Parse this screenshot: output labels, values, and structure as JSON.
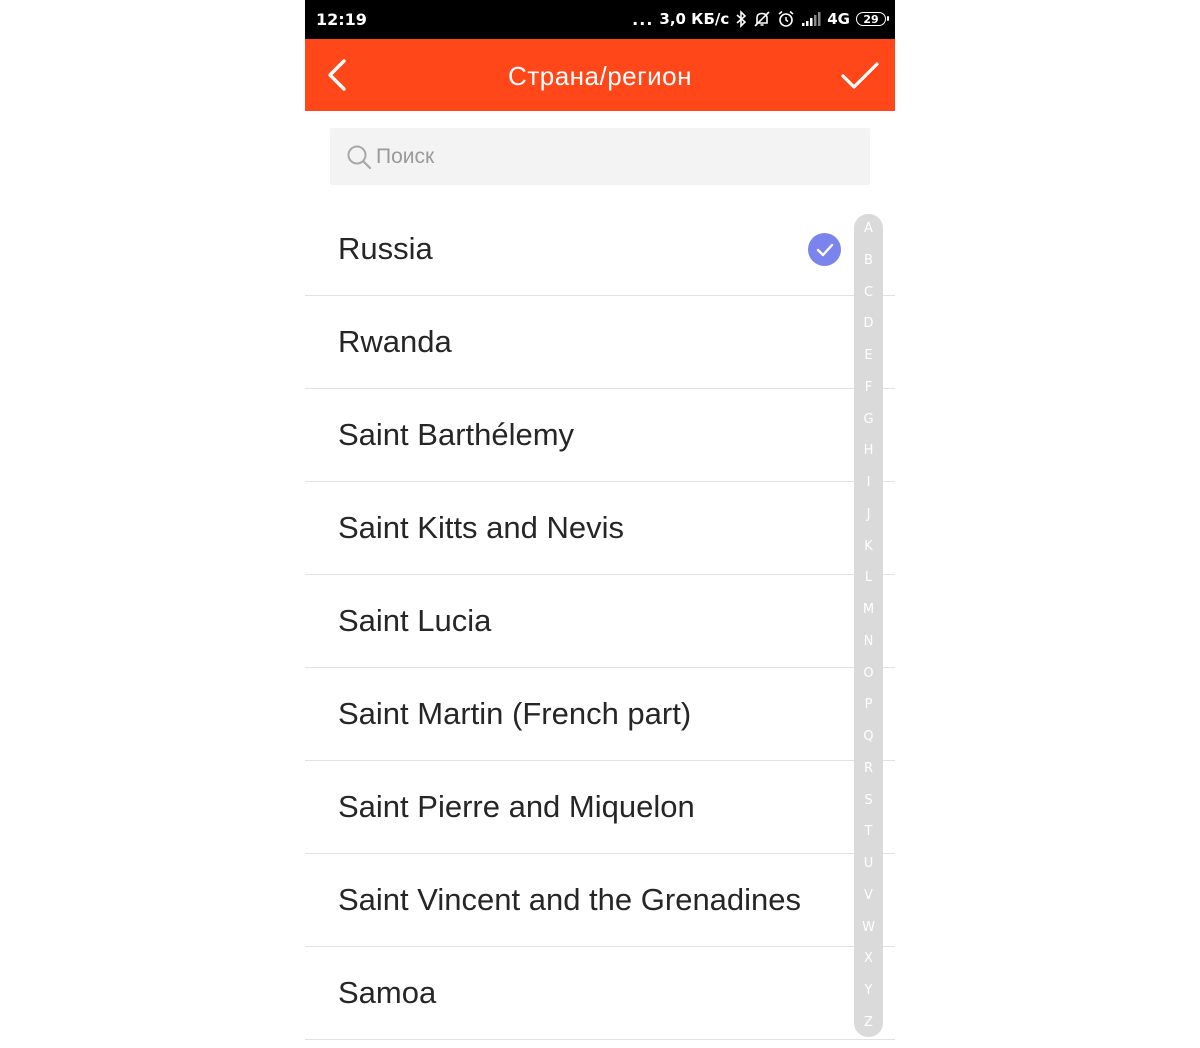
{
  "status_bar": {
    "time": "12:19",
    "dots": "...",
    "speed": "3,0 КБ/с",
    "network": "4G",
    "battery": "29"
  },
  "header": {
    "title": "Страна/регион",
    "accent_color": "#ff471a"
  },
  "search": {
    "placeholder": "Поиск"
  },
  "countries": [
    {
      "name": "Russia",
      "selected": true
    },
    {
      "name": "Rwanda",
      "selected": false
    },
    {
      "name": "Saint Barthélemy",
      "selected": false
    },
    {
      "name": "Saint Kitts and Nevis",
      "selected": false
    },
    {
      "name": "Saint Lucia",
      "selected": false
    },
    {
      "name": "Saint Martin (French part)",
      "selected": false
    },
    {
      "name": "Saint Pierre and Miquelon",
      "selected": false
    },
    {
      "name": "Saint Vincent and the Grenadines",
      "selected": false
    },
    {
      "name": "Samoa",
      "selected": false
    }
  ],
  "alphabet": [
    "A",
    "B",
    "C",
    "D",
    "E",
    "F",
    "G",
    "H",
    "I",
    "J",
    "K",
    "L",
    "M",
    "N",
    "O",
    "P",
    "Q",
    "R",
    "S",
    "T",
    "U",
    "V",
    "W",
    "X",
    "Y",
    "Z"
  ],
  "colors": {
    "selected_check": "#7b84ec",
    "index_bar": "#dadada"
  }
}
